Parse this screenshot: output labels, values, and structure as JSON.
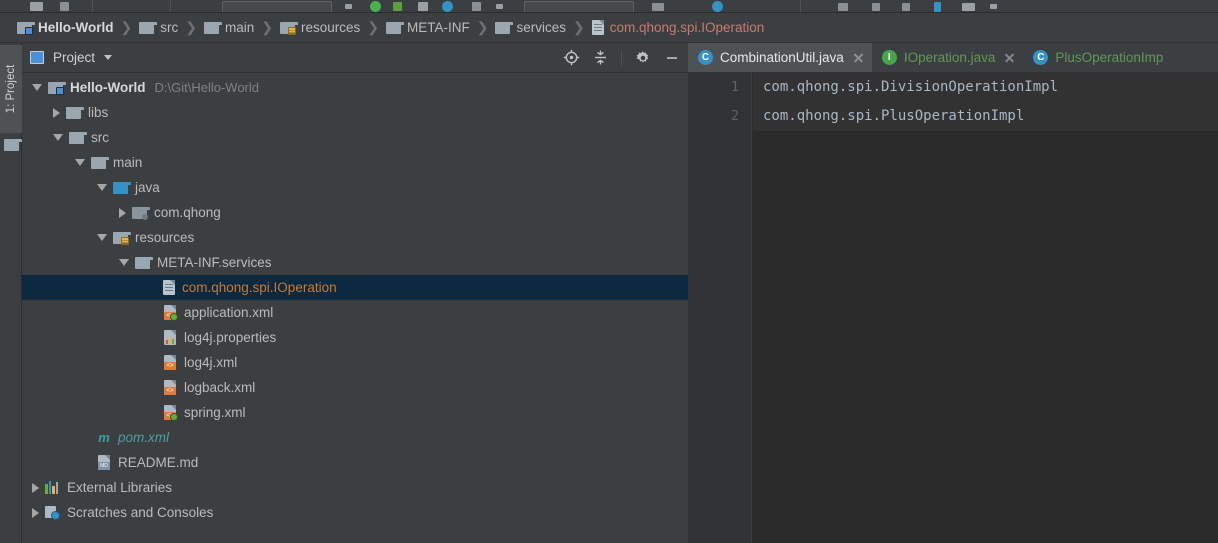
{
  "colors": {
    "background": "#3c3f41",
    "editor_background": "#2b2b2b",
    "selection": "#0d293f",
    "selected_text": "#cc7832",
    "green_tab_text": "#629755",
    "breadcrumb_file": "#c87a72",
    "teal": "#4e9ca8"
  },
  "tool_rail": {
    "tab_label": "1: Project",
    "folder_icon": "folder-icon"
  },
  "breadcrumbs": [
    {
      "label": "Hello-World",
      "icon": "module-folder-icon",
      "type": "module"
    },
    {
      "label": "src",
      "icon": "folder-icon",
      "type": "folder"
    },
    {
      "label": "main",
      "icon": "folder-icon",
      "type": "folder"
    },
    {
      "label": "resources",
      "icon": "resources-folder-icon",
      "type": "resources"
    },
    {
      "label": "META-INF",
      "icon": "folder-icon",
      "type": "folder"
    },
    {
      "label": "services",
      "icon": "folder-icon",
      "type": "folder"
    },
    {
      "label": "com.qhong.spi.IOperation",
      "icon": "file-icon",
      "type": "file"
    }
  ],
  "breadcrumb_separator": "❯",
  "panel": {
    "icon": "project-panel-icon",
    "title": "Project",
    "caret": "chevron-down-icon",
    "actions": [
      {
        "name": "locate-icon",
        "title": "Select Opened File"
      },
      {
        "name": "collapse-all-icon",
        "title": "Collapse All"
      },
      {
        "name": "gear-icon",
        "title": "Settings"
      },
      {
        "name": "minimize-icon",
        "title": "Hide"
      }
    ]
  },
  "tree": [
    {
      "label": "Hello-World",
      "sublabel": "D:\\Git\\Hello-World",
      "indent": 0,
      "arrow": "expanded",
      "icon": "module-folder-icon",
      "selected": false
    },
    {
      "label": "libs",
      "sublabel": "",
      "indent": 1,
      "arrow": "collapsed",
      "icon": "folder-icon",
      "selected": false
    },
    {
      "label": "src",
      "sublabel": "",
      "indent": 1,
      "arrow": "expanded",
      "icon": "folder-icon",
      "selected": false
    },
    {
      "label": "main",
      "sublabel": "",
      "indent": 2,
      "arrow": "expanded",
      "icon": "folder-icon",
      "selected": false
    },
    {
      "label": "java",
      "sublabel": "",
      "indent": 3,
      "arrow": "expanded",
      "icon": "source-folder-icon",
      "selected": false
    },
    {
      "label": "com.qhong",
      "sublabel": "",
      "indent": 4,
      "arrow": "collapsed",
      "icon": "package-icon",
      "selected": false
    },
    {
      "label": "resources",
      "sublabel": "",
      "indent": 3,
      "arrow": "expanded",
      "icon": "resources-folder-icon",
      "selected": false
    },
    {
      "label": "META-INF.services",
      "sublabel": "",
      "indent": 4,
      "arrow": "expanded",
      "icon": "folder-icon",
      "selected": false
    },
    {
      "label": "com.qhong.spi.IOperation",
      "sublabel": "",
      "indent": 5,
      "arrow": "none",
      "icon": "file-icon",
      "selected": true
    },
    {
      "label": "application.xml",
      "sublabel": "",
      "indent": 5,
      "arrow": "none",
      "icon": "spring-xml-icon",
      "selected": false
    },
    {
      "label": "log4j.properties",
      "sublabel": "",
      "indent": 5,
      "arrow": "none",
      "icon": "properties-icon",
      "selected": false
    },
    {
      "label": "log4j.xml",
      "sublabel": "",
      "indent": 5,
      "arrow": "none",
      "icon": "xml-icon",
      "selected": false
    },
    {
      "label": "logback.xml",
      "sublabel": "",
      "indent": 5,
      "arrow": "none",
      "icon": "xml-icon",
      "selected": false
    },
    {
      "label": "spring.xml",
      "sublabel": "",
      "indent": 5,
      "arrow": "none",
      "icon": "spring-xml-icon",
      "selected": false
    },
    {
      "label": "pom.xml",
      "sublabel": "",
      "indent": 3,
      "arrow": "none",
      "icon": "maven-icon",
      "selected": false,
      "style": "teal"
    },
    {
      "label": "README.md",
      "sublabel": "",
      "indent": 3,
      "arrow": "none",
      "icon": "markdown-icon",
      "selected": false
    },
    {
      "label": "External Libraries",
      "sublabel": "",
      "indent": 0,
      "arrow": "collapsed",
      "icon": "libraries-icon",
      "selected": false
    },
    {
      "label": "Scratches and Consoles",
      "sublabel": "",
      "indent": 0,
      "arrow": "collapsed",
      "icon": "scratches-icon",
      "selected": false
    }
  ],
  "editor": {
    "tabs": [
      {
        "label": "CombinationUtil.java",
        "icon": "class-icon",
        "state": "active",
        "closable": true
      },
      {
        "label": "IOperation.java",
        "icon": "interface-icon",
        "state": "green",
        "closable": true
      },
      {
        "label": "PlusOperationImp",
        "icon": "class-icon",
        "state": "green",
        "closable": false
      }
    ],
    "line_numbers": [
      "1",
      "2"
    ],
    "lines": [
      {
        "text": "com.qhong.spi.DivisionOperationImpl",
        "highlighted": true
      },
      {
        "text": "com.qhong.spi.PlusOperationImpl",
        "highlighted": true
      }
    ]
  }
}
